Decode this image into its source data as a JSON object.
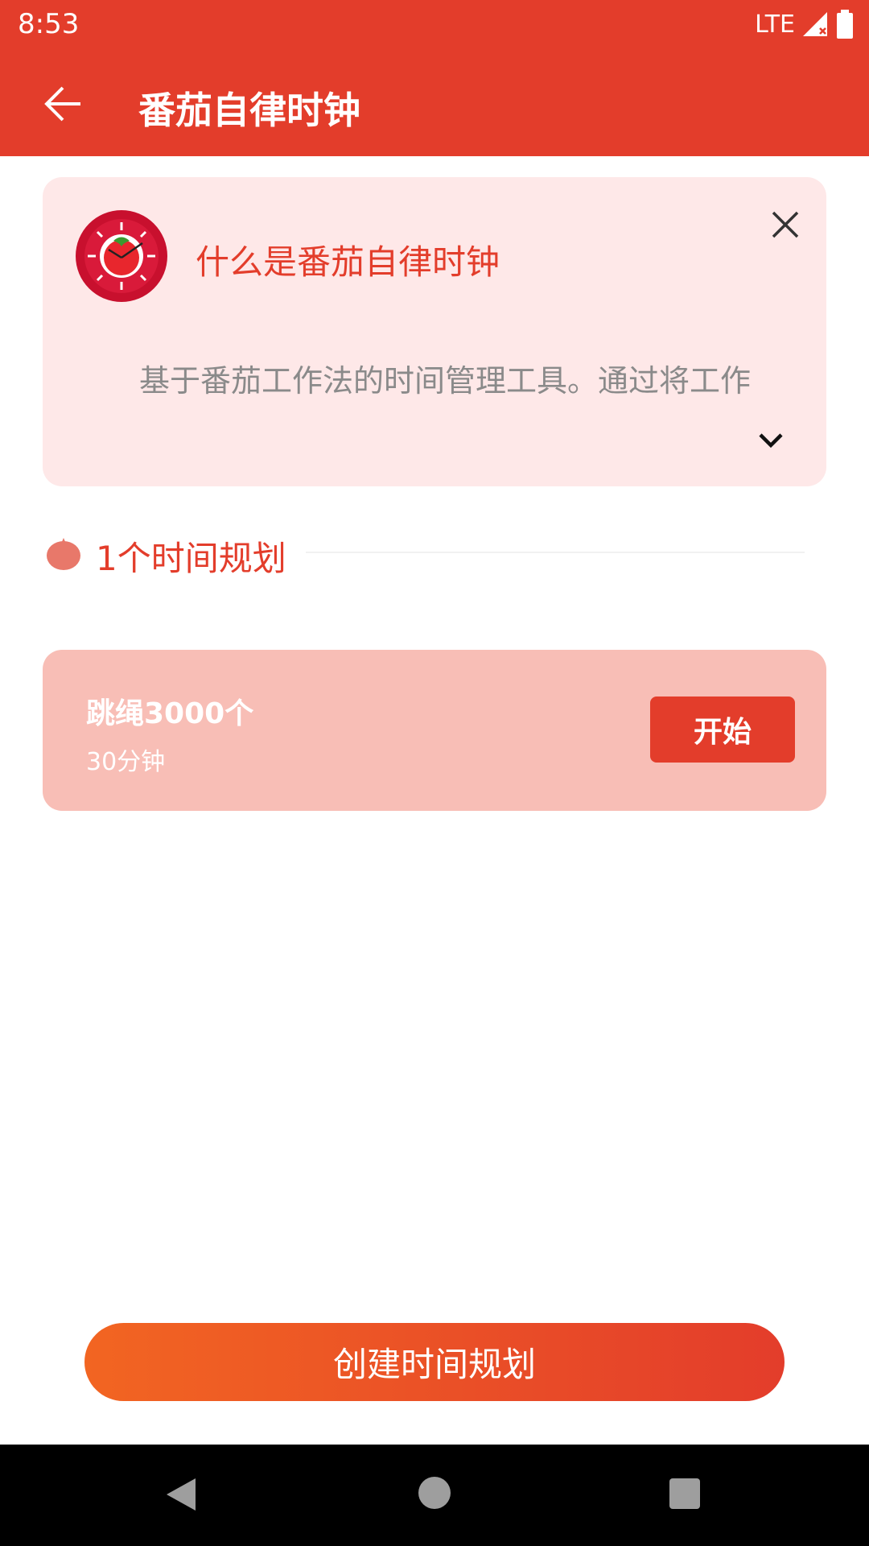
{
  "status": {
    "time": "8:53",
    "network": "LTE"
  },
  "appbar": {
    "title": "番茄自律时钟",
    "back_icon": "arrow-left-icon"
  },
  "intro": {
    "title": "什么是番茄自律时钟",
    "description": "基于番茄工作法的时间管理工具。通过将工作",
    "logo_icon": "tomato-clock-icon",
    "close_icon": "close-icon",
    "expand_icon": "chevron-down-icon"
  },
  "plans_section": {
    "count_label": "1个时间规划",
    "icon": "tomato-icon"
  },
  "plans": [
    {
      "name": "跳绳3000个",
      "duration": "30分钟",
      "action": "开始"
    }
  ],
  "create_button": {
    "label": "创建时间规划"
  },
  "colors": {
    "primary": "#E33D2B",
    "card_bg": "#FEE8E8",
    "plan_bg": "#F8BEB6",
    "gradient_start": "#F26522",
    "gradient_end": "#E33D2B"
  }
}
